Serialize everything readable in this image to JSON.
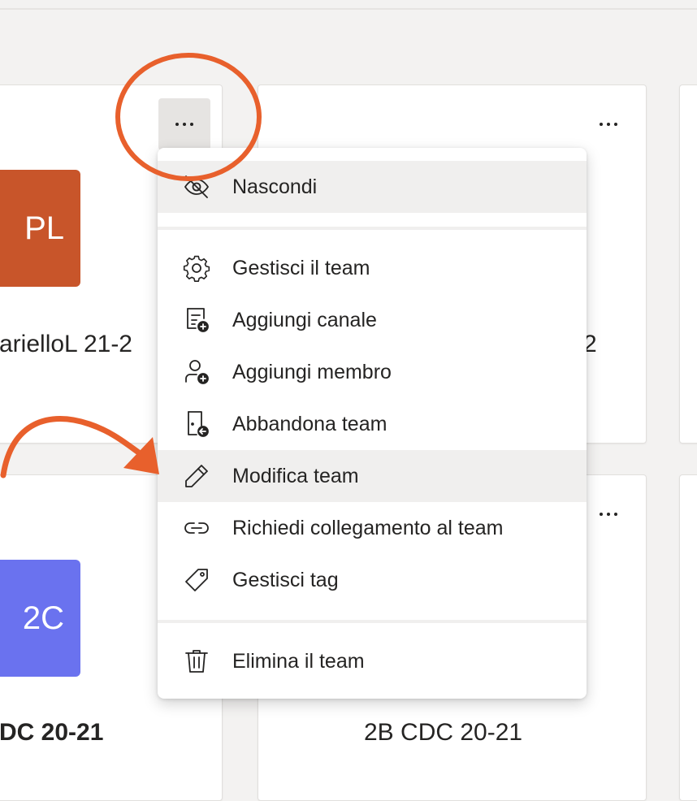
{
  "colors": {
    "background": "#f3f2f1",
    "annotation": "#e8602c",
    "tile_pl": "#c8552a",
    "tile_2c": "#6a72ef"
  },
  "teams": [
    {
      "initials": "PL",
      "name": "arielloL 21-2",
      "tile_color": "#c8552a"
    },
    {
      "name_fragment": "2"
    },
    {
      "initials": "2C",
      "name": "DC 20-21",
      "tile_color": "#6a72ef"
    },
    {
      "name": "2B CDC 20-21"
    }
  ],
  "menu": {
    "items": [
      {
        "label": "Nascondi",
        "icon": "hide-icon",
        "highlighted": true
      },
      {
        "label": "Gestisci il team",
        "icon": "gear-icon"
      },
      {
        "label": "Aggiungi canale",
        "icon": "add-channel-icon"
      },
      {
        "label": "Aggiungi membro",
        "icon": "add-member-icon"
      },
      {
        "label": "Abbandona team",
        "icon": "leave-icon"
      },
      {
        "label": "Modifica team",
        "icon": "pencil-icon",
        "highlighted": true
      },
      {
        "label": "Richiedi collegamento al team",
        "icon": "link-icon"
      },
      {
        "label": "Gestisci tag",
        "icon": "tag-icon"
      },
      {
        "label": "Elimina il team",
        "icon": "trash-icon"
      }
    ]
  }
}
